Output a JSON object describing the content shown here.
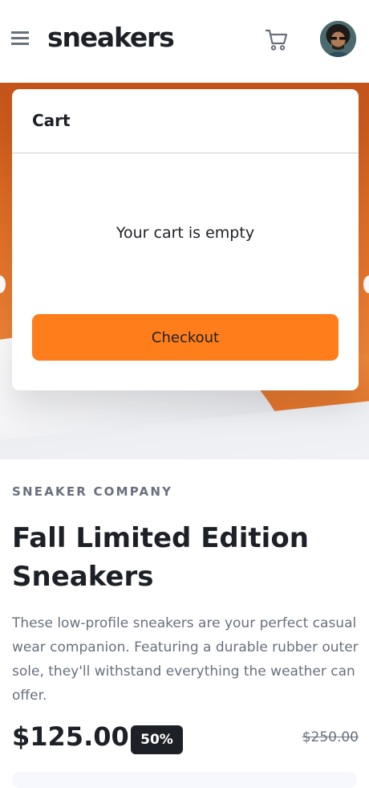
{
  "header": {
    "logo": "sneakers",
    "icons": {
      "menu": "hamburger-menu-icon",
      "cart": "cart-icon",
      "avatar": "user-avatar"
    }
  },
  "cart": {
    "title": "Cart",
    "empty_message": "Your cart is empty",
    "checkout_label": "Checkout"
  },
  "product": {
    "company": "SNEAKER COMPANY",
    "title": "Fall Limited Edition Sneakers",
    "description": "These low-profile sneakers are your perfect casual wear companion. Featuring a durable rubber outer sole, they'll withstand everything the weather can offer.",
    "price": "$125.00",
    "discount": "50%",
    "original_price": "$250.00"
  },
  "colors": {
    "accent": "#ff7e1b",
    "dark": "#1d2026",
    "muted": "#69707d"
  }
}
